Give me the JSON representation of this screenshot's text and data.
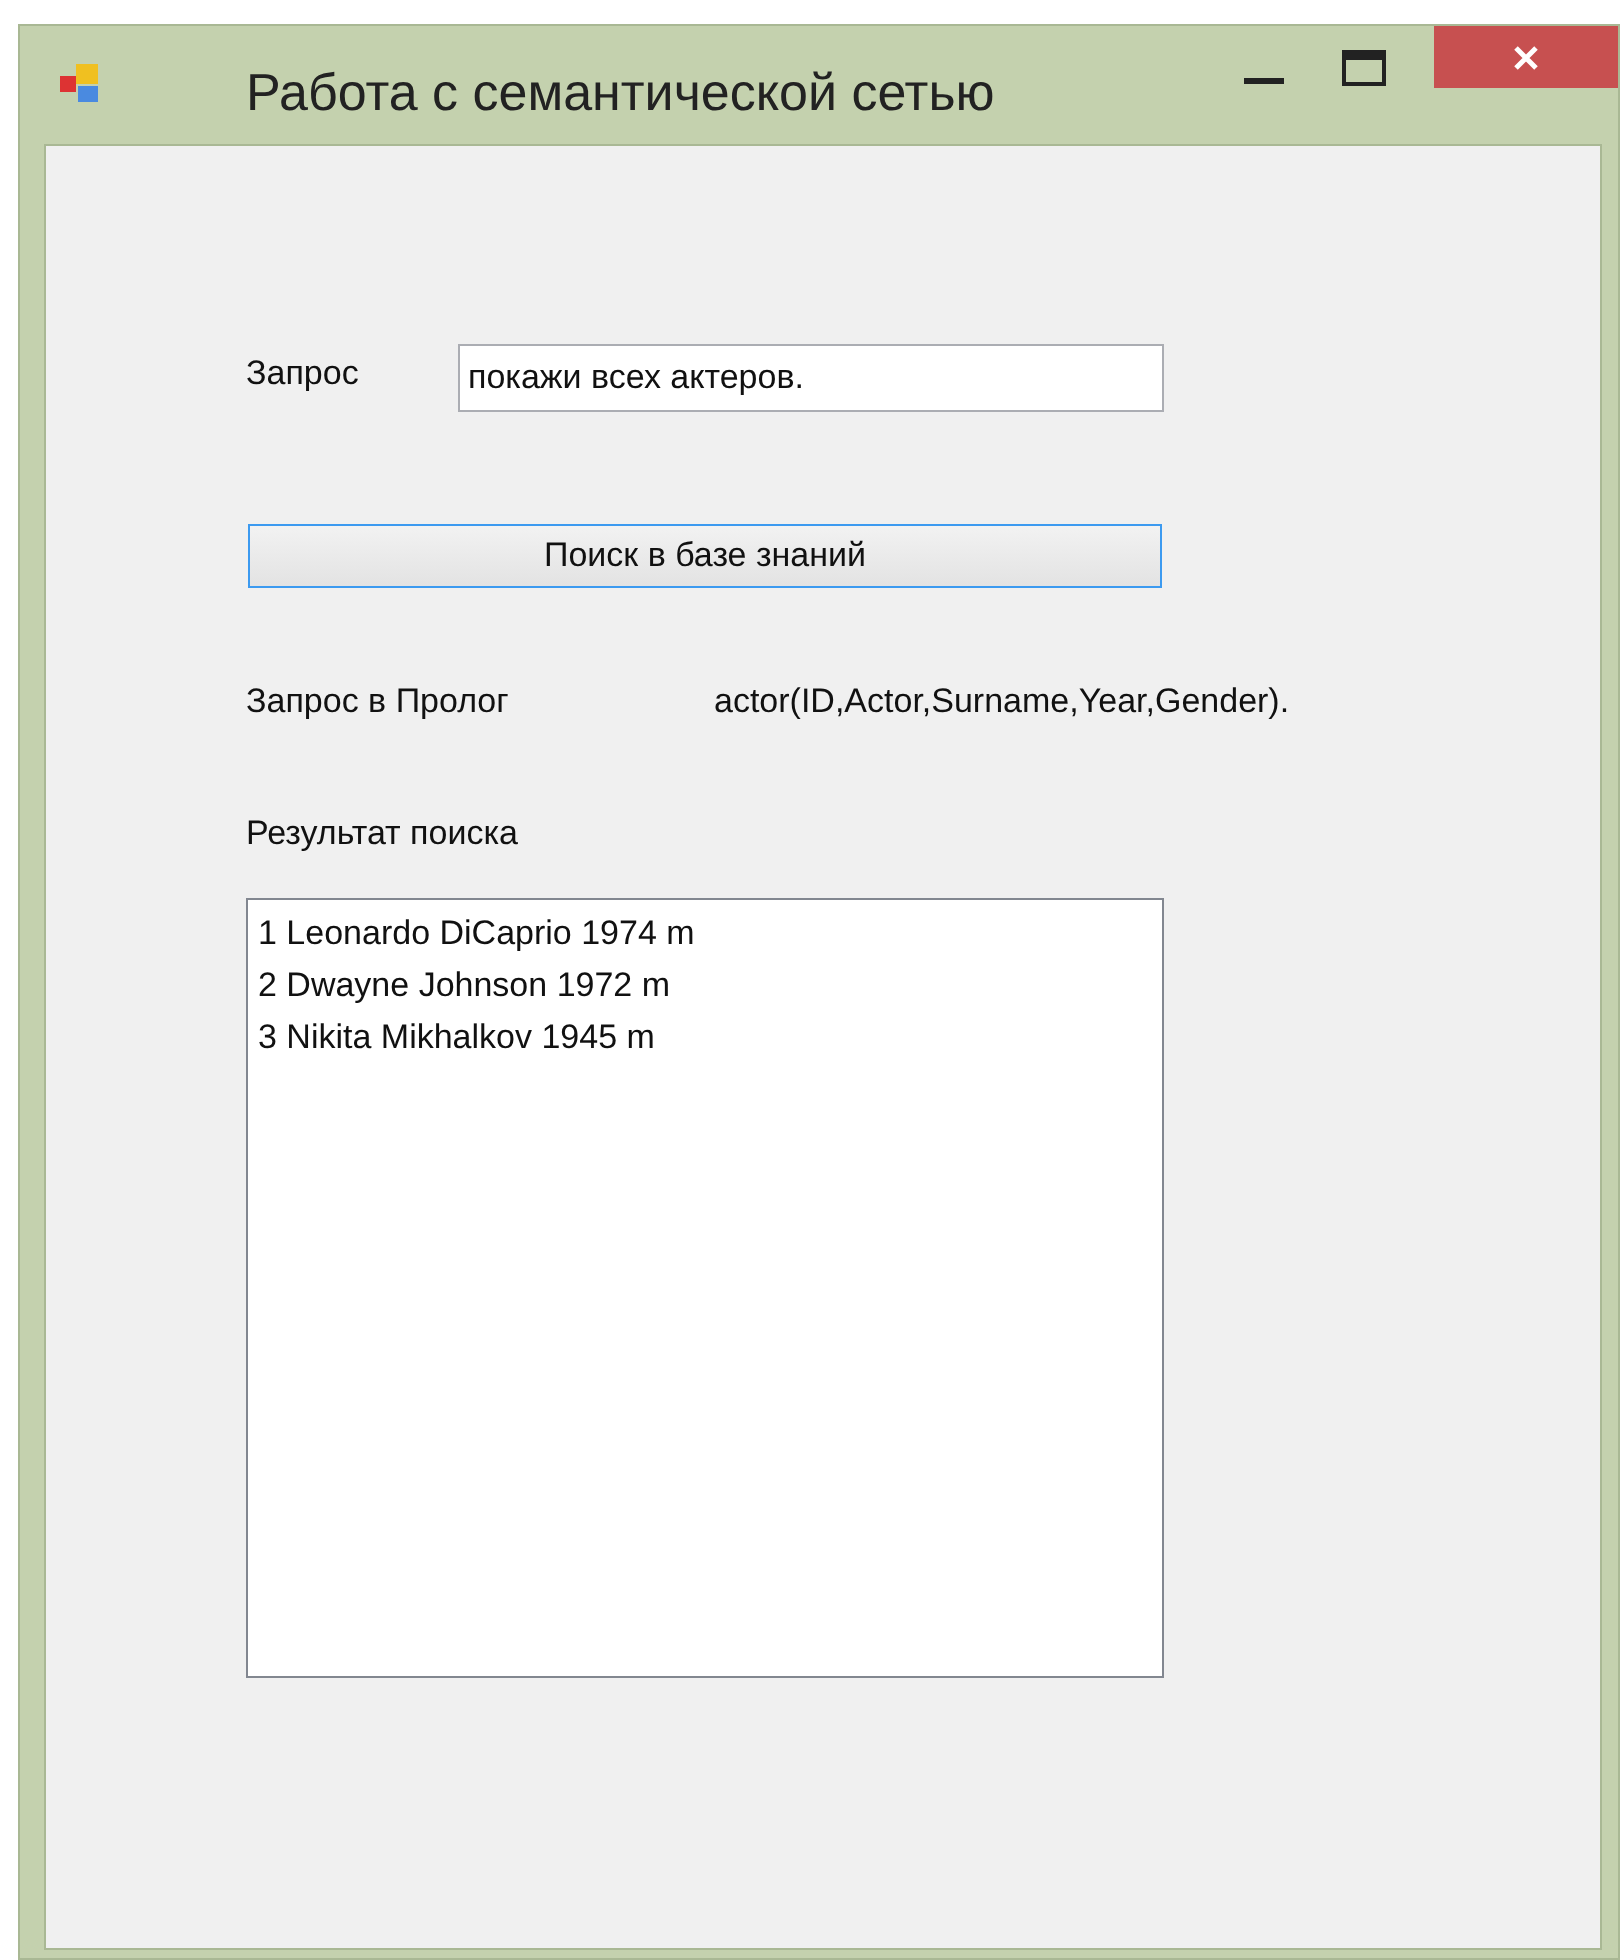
{
  "window": {
    "title": "Работа с семантической сетью"
  },
  "query": {
    "label": "Запрос",
    "value": "покажи всех актеров."
  },
  "search_button": {
    "label": "Поиск в базе знаний",
    "focused": true
  },
  "prolog": {
    "label": "Запрос в Пролог",
    "value": "actor(ID,Actor,Surname,Year,Gender)."
  },
  "results": {
    "label": "Результат поиска",
    "items": [
      "1 Leonardo DiCaprio 1974 m",
      "2 Dwayne Johnson 1972 m",
      "3 Nikita Mikhalkov 1945 m"
    ]
  }
}
